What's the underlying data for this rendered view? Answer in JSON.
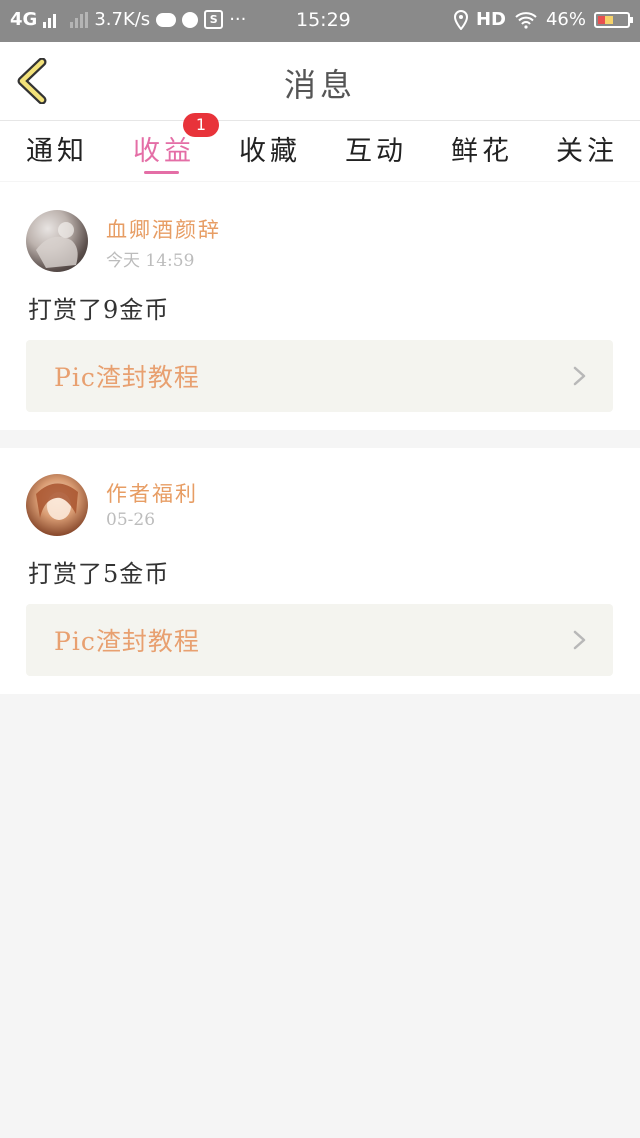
{
  "status_bar": {
    "network": "4G",
    "speed": "3.7K/s",
    "time": "15:29",
    "hd": "HD",
    "battery": "46%",
    "battery_level": 0.46
  },
  "header": {
    "title": "消息"
  },
  "tabs": [
    {
      "label": "通知",
      "active": false
    },
    {
      "label": "收益",
      "active": true,
      "badge": "1"
    },
    {
      "label": "收藏",
      "active": false
    },
    {
      "label": "互动",
      "active": false
    },
    {
      "label": "鲜花",
      "active": false
    },
    {
      "label": "关注",
      "active": false
    }
  ],
  "messages": [
    {
      "user": "血卿酒颜辞",
      "time": "今天 14:59",
      "text": "打赏了9金币",
      "link": "Pic渣封教程"
    },
    {
      "user": "作者福利",
      "time": "05-26",
      "text": "打赏了5金币",
      "link": "Pic渣封教程"
    }
  ],
  "colors": {
    "accent": "#e46ea6",
    "username": "#e79d64",
    "badge": "#e8333a",
    "link_bg": "#f4f4ef"
  }
}
